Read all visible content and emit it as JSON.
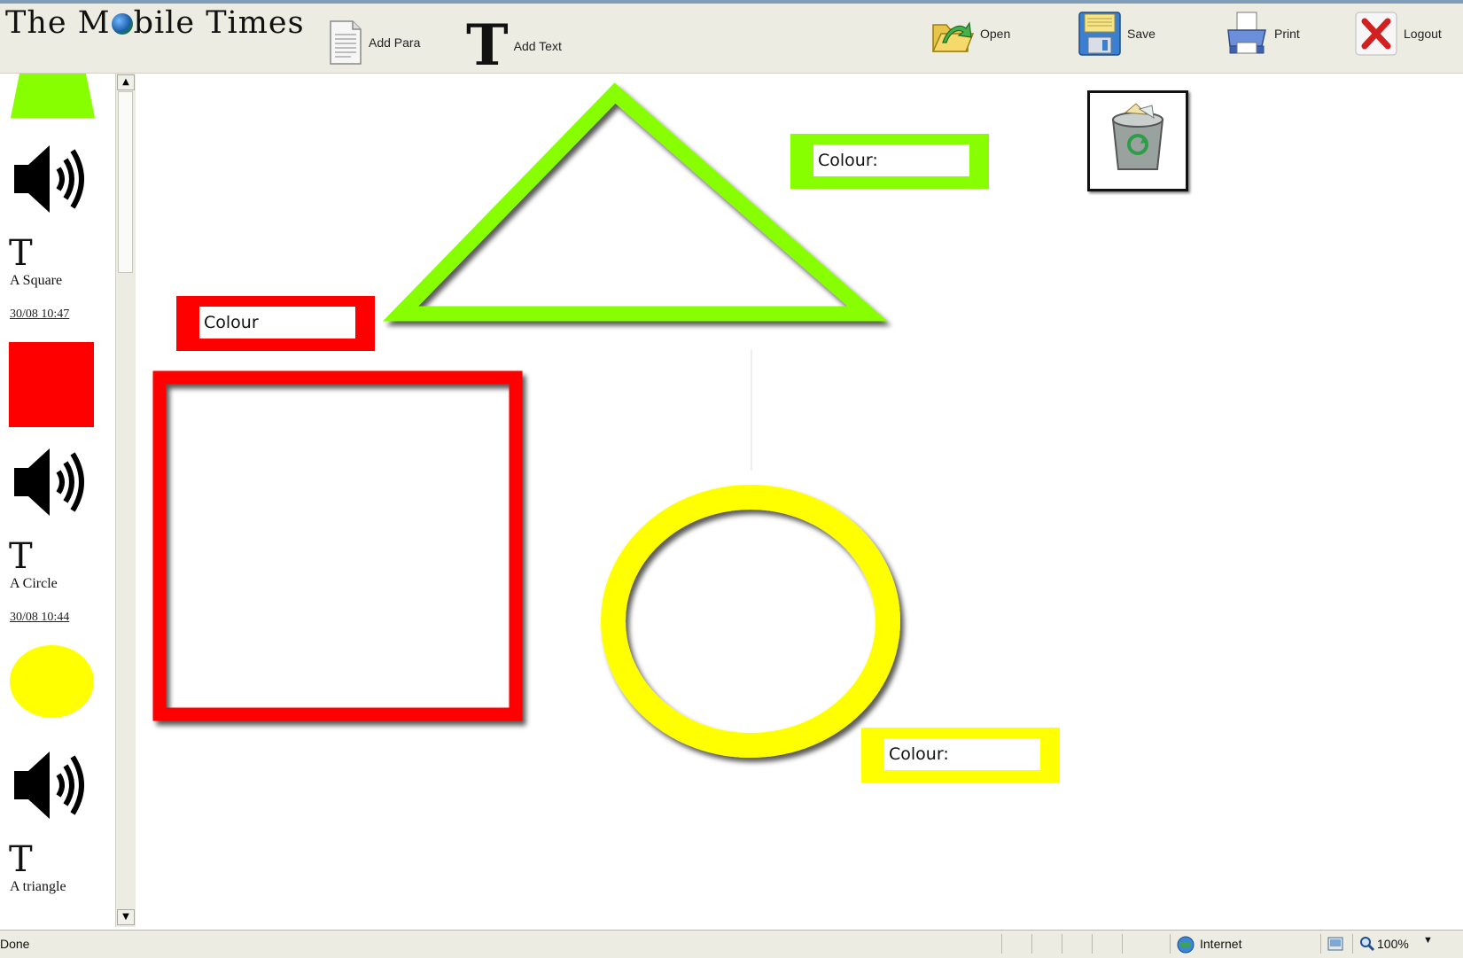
{
  "header": {
    "logo_part1": "The M",
    "logo_part2": "bile Times",
    "add_para": "Add Para",
    "add_text": "Add Text",
    "big_t": "T",
    "open": "Open",
    "save": "Save",
    "print": "Print",
    "logout": "Logout"
  },
  "sidebar": {
    "items": [
      {
        "t": "T",
        "label": "A Square",
        "date": "30/08 10:47"
      },
      {
        "t": "T",
        "label": "A Circle",
        "date": "30/08 10:44"
      },
      {
        "t": "T",
        "label": "A triangle"
      }
    ],
    "scroll_up": "▲",
    "scroll_down": "▼"
  },
  "canvas": {
    "triangle_colour_label": "Colour:",
    "square_colour_label": "Colour",
    "circle_colour_label": "Colour:",
    "colors": {
      "triangle": "#88ff00",
      "square": "#ff0000",
      "circle": "#ffff00"
    }
  },
  "status": {
    "left": "Done",
    "zone": "Internet",
    "zoom": "100%"
  }
}
